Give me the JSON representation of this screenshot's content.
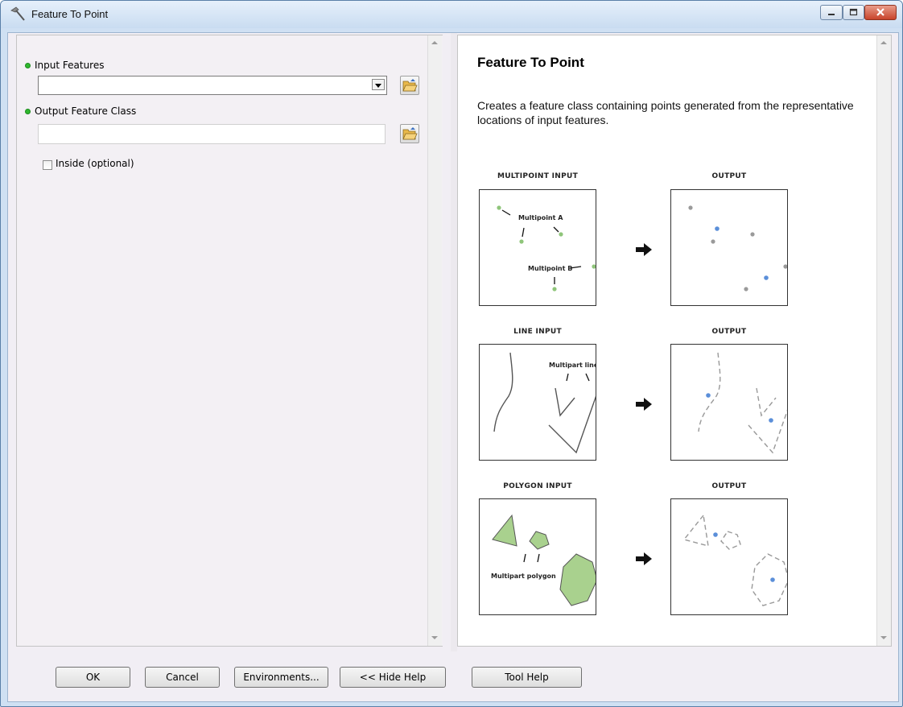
{
  "window": {
    "title": "Feature To Point",
    "icon": "hammer-icon"
  },
  "parameters": {
    "input_features": {
      "label": "Input Features",
      "value": "",
      "browse_icon": "open-folder-icon"
    },
    "output_feature_class": {
      "label": "Output Feature Class",
      "value": "",
      "browse_icon": "open-folder-icon"
    },
    "inside": {
      "label": "Inside (optional)",
      "checked": false
    }
  },
  "help": {
    "title": "Feature To Point",
    "description": "Creates a feature class containing points generated from the representative locations of input features.",
    "figures": [
      {
        "input_label": "MULTIPOINT INPUT",
        "output_label": "OUTPUT",
        "annotations": [
          "Multipoint A",
          "Multipoint B"
        ]
      },
      {
        "input_label": "LINE INPUT",
        "output_label": "OUTPUT",
        "annotations": [
          "Multipart line"
        ]
      },
      {
        "input_label": "POLYGON INPUT",
        "output_label": "OUTPUT",
        "annotations": [
          "Multipart polygon"
        ]
      }
    ]
  },
  "buttons": {
    "ok": "OK",
    "cancel": "Cancel",
    "environments": "Environments...",
    "hide_help": "<< Hide Help",
    "tool_help": "Tool Help"
  },
  "colors": {
    "input_point": "#8fc57a",
    "output_point": "#5b8fd9",
    "grey_point": "#9a9a9a",
    "polygon_fill": "#a9d18e",
    "required_dot": "#2fb82f"
  }
}
